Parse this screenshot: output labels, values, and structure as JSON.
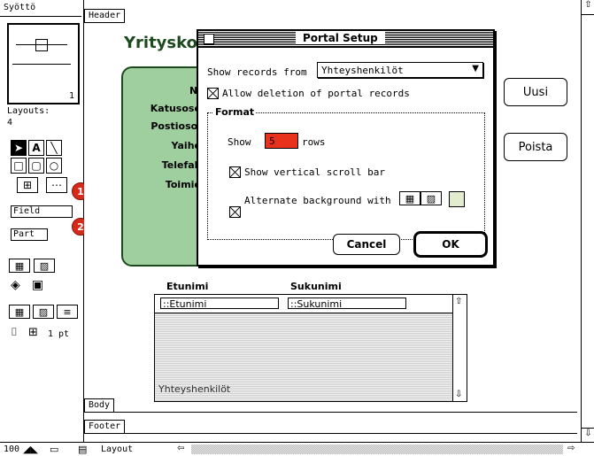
{
  "palette": {
    "title": "Syöttö",
    "book_page": "1",
    "layouts_label": "Layouts:",
    "layouts_count": "4",
    "tools": [
      "arrow-tool",
      "text-tool",
      "line-tool",
      "rect-tool",
      "rounded-rect-tool",
      "oval-tool",
      "portal-tool",
      "field-tool"
    ],
    "field_button": "Field",
    "part_button": "Part",
    "badge1": "1",
    "badge2": "2",
    "line_width": "1 pt"
  },
  "document": {
    "header_tab": "Header",
    "title_partial": "Yritysko",
    "labels": [
      "Ni",
      "Katusoso",
      "Postiosoi",
      "Yaihe",
      "Telefak",
      "Toimio"
    ],
    "buttons": [
      "Uusi",
      "Poista"
    ],
    "portal_col1": "Etunimi",
    "portal_col2": "Sukunimi",
    "portal_field1": "::Etunimi",
    "portal_field2": "::Sukunimi",
    "portal_name": "Yhteyshenkilöt",
    "body_tab": "Body",
    "footer_tab": "Footer",
    "zoom": "100",
    "mode": "Layout"
  },
  "dialog": {
    "title": "Portal Setup",
    "show_records_label": "Show records from",
    "show_records_value": "Yhteyshenkilöt",
    "allow_deletion": "Allow deletion of portal records",
    "format_label": "Format",
    "show_label": "Show",
    "rows_value": "5",
    "rows_label": "rows",
    "scrollbar_label": "Show vertical scroll bar",
    "alternate_label": "Alternate background with",
    "cancel": "Cancel",
    "ok": "OK",
    "colors": {
      "rows_field": "#e8321e",
      "alt_swatch": "#e4ecd0",
      "green_panel": "#9fcf9f"
    }
  }
}
